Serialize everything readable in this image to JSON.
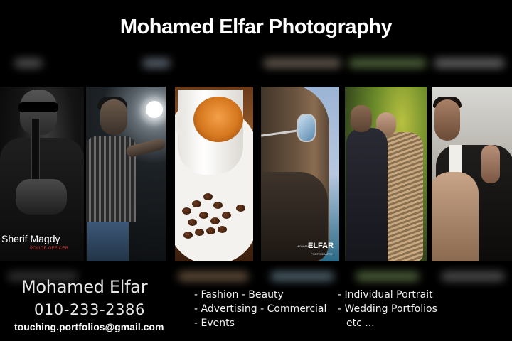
{
  "header": {
    "title": "Mohamed Elfar Photography"
  },
  "photos": [
    {
      "caption_name": "Sherif Magdy",
      "caption_role": "POLICE OFFICER"
    },
    {},
    {},
    {
      "logo_top": "MOHAMED",
      "logo_main": "ELFAR",
      "logo_sub": "PHOTOGRAPHY"
    },
    {},
    {}
  ],
  "contact": {
    "name": "Mohamed Elfar",
    "phone": "010-233-2386",
    "email": "touching.portfolios@gmail.com"
  },
  "services": {
    "column1": [
      "- Fashion - Beauty",
      "- Advertising - Commercial",
      "- Events"
    ],
    "column2": [
      "- Individual Portrait",
      "- Wedding Portfolios",
      "etc ..."
    ]
  },
  "colors": {
    "background": "#000000",
    "text": "#ffffff",
    "caption_accent": "#e03030"
  }
}
